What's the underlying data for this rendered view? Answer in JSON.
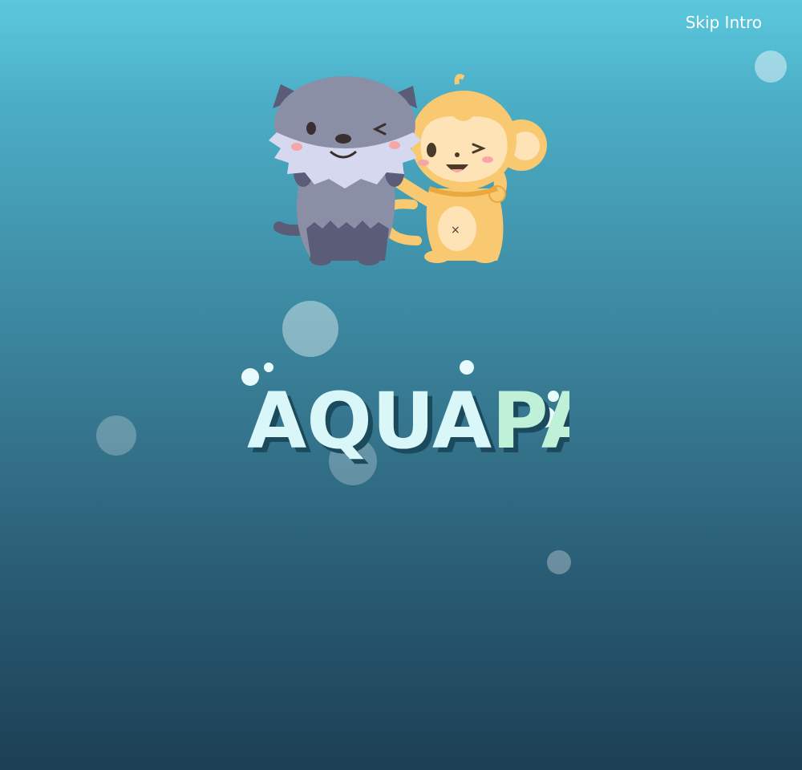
{
  "skip_button": {
    "label": "Skip Intro"
  },
  "logo": {
    "part1": "AQUA",
    "part2": "PAL"
  },
  "colors": {
    "logo_part1": "#d9f6f8",
    "logo_part2": "#bff0d8",
    "logo_shadow": "#1b4a5c",
    "cat_fur": "#8b8fa6",
    "cat_dark": "#5a5c78",
    "cat_mane": "#d6d8f0",
    "monkey_fur": "#f8c970",
    "monkey_face": "#fde3b5"
  },
  "icons": {
    "cat_mascot": "cat-mascot-icon",
    "monkey_mascot": "monkey-mascot-icon"
  }
}
